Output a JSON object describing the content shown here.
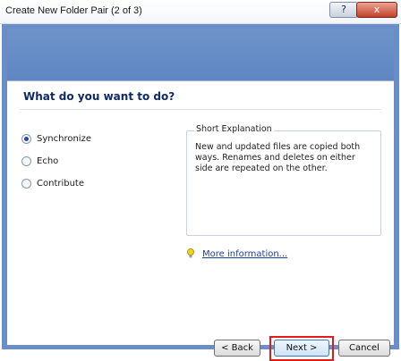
{
  "window": {
    "title": "Create New Folder Pair (2 of 3)",
    "help_glyph": "?",
    "close_glyph": "x"
  },
  "main": {
    "question": "What do you want to do?",
    "options": [
      {
        "label": "Synchronize",
        "selected": true
      },
      {
        "label": "Echo",
        "selected": false
      },
      {
        "label": "Contribute",
        "selected": false
      }
    ],
    "explanation_title": "Short Explanation",
    "explanation_text": "New and updated files are copied both ways. Renames and deletes on either side are repeated on the other.",
    "more_info": "More information..."
  },
  "buttons": {
    "back": "< Back",
    "next": "Next >",
    "cancel": "Cancel"
  },
  "colors": {
    "accent": "#1f4da3",
    "highlight": "#e31b1b"
  }
}
